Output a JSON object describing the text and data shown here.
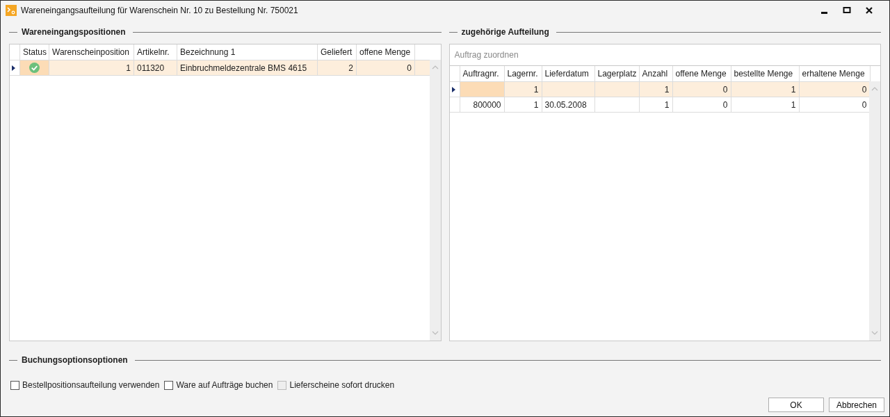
{
  "window": {
    "title": "Wareneingangsaufteilung für Warenschein Nr. 10 zu Bestellung Nr. 750021"
  },
  "left_panel": {
    "title": "Wareneingangspositionen",
    "columns": [
      {
        "label": "Status",
        "kind": "status"
      },
      {
        "label": "Warenscheinposition",
        "kind": "number"
      },
      {
        "label": "Artikelnr.",
        "kind": "text"
      },
      {
        "label": "Bezeichnung 1",
        "kind": "text"
      },
      {
        "label": "Geliefert",
        "kind": "number"
      },
      {
        "label": "offene Menge",
        "kind": "number"
      }
    ],
    "rows": [
      {
        "selected": true,
        "done": true,
        "cells": [
          null,
          "1",
          "011320",
          "Einbruchmeldezentrale BMS 4615",
          "2",
          "0"
        ]
      }
    ]
  },
  "right_panel": {
    "title": "zugehörige Aufteilung",
    "search": {
      "placeholder": "Auftrag zuordnen"
    },
    "columns": [
      {
        "label": "Auftragnr.",
        "kind": "number"
      },
      {
        "label": "Lagernr.",
        "kind": "number"
      },
      {
        "label": "Lieferdatum",
        "kind": "text"
      },
      {
        "label": "Lagerplatz",
        "kind": "text"
      },
      {
        "label": "Anzahl",
        "kind": "number"
      },
      {
        "label": "offene Menge",
        "kind": "number"
      },
      {
        "label": "bestellte Menge",
        "kind": "number"
      },
      {
        "label": "erhaltene Menge",
        "kind": "number"
      }
    ],
    "rows": [
      {
        "selected": true,
        "cells": [
          null,
          "1",
          null,
          null,
          "1",
          "0",
          "1",
          "0"
        ]
      },
      {
        "selected": false,
        "cells": [
          "800000",
          "1",
          "30.05.2008",
          null,
          "1",
          "0",
          "1",
          "0"
        ]
      }
    ]
  },
  "options": {
    "title": "Buchungsoptionsoptionen",
    "checkboxes": [
      {
        "label": "Bestellpositionsaufteilung verwenden",
        "checked": false,
        "disabled": false
      },
      {
        "label": "Ware auf Aufträge buchen",
        "checked": false,
        "disabled": false
      },
      {
        "label": "Lieferscheine sofort drucken",
        "checked": false,
        "disabled": true
      }
    ]
  },
  "buttons": [
    {
      "label": "OK"
    },
    {
      "label": "Abbrechen"
    }
  ]
}
